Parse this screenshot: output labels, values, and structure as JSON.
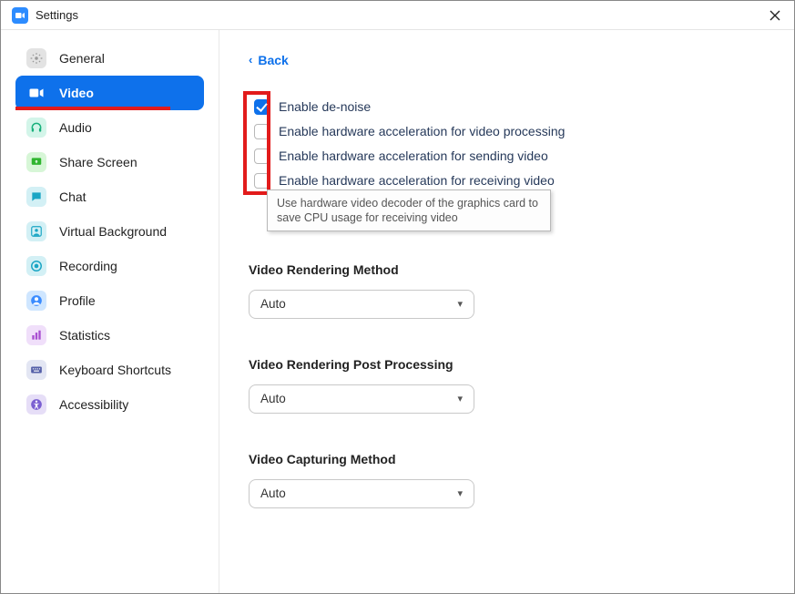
{
  "window": {
    "title": "Settings"
  },
  "sidebar": {
    "items": [
      {
        "label": "General"
      },
      {
        "label": "Video"
      },
      {
        "label": "Audio"
      },
      {
        "label": "Share Screen"
      },
      {
        "label": "Chat"
      },
      {
        "label": "Virtual Background"
      },
      {
        "label": "Recording"
      },
      {
        "label": "Profile"
      },
      {
        "label": "Statistics"
      },
      {
        "label": "Keyboard Shortcuts"
      },
      {
        "label": "Accessibility"
      }
    ],
    "active_index": 1
  },
  "content": {
    "back_label": "Back",
    "checkboxes": [
      {
        "label": "Enable de-noise",
        "checked": true
      },
      {
        "label": "Enable hardware acceleration for video processing",
        "checked": false
      },
      {
        "label": "Enable hardware acceleration for sending video",
        "checked": false
      },
      {
        "label": "Enable hardware acceleration for receiving video",
        "checked": false
      }
    ],
    "tooltip": "Use hardware video decoder of the graphics card to save CPU usage for receiving video",
    "sections": [
      {
        "label": "Video Rendering Method",
        "value": "Auto"
      },
      {
        "label": "Video Rendering Post Processing",
        "value": "Auto"
      },
      {
        "label": "Video Capturing Method",
        "value": "Auto"
      }
    ]
  }
}
